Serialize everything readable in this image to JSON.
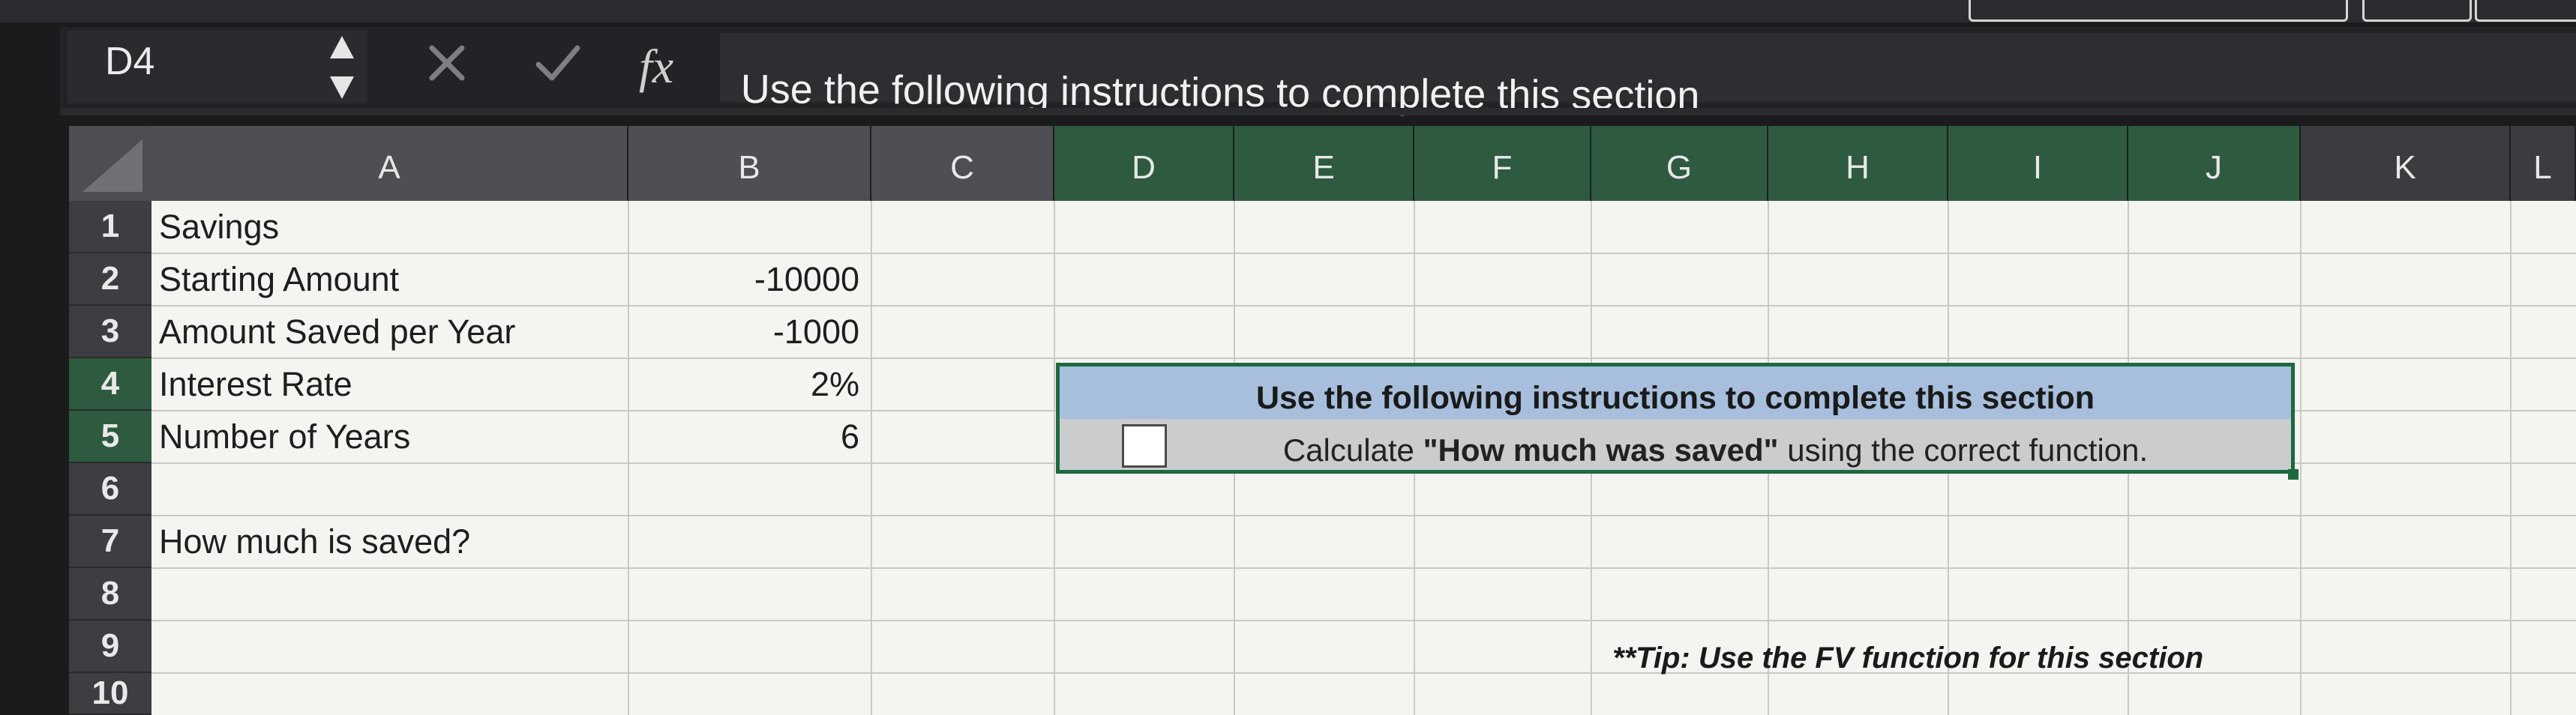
{
  "formula_bar": {
    "name_box": "D4",
    "fx_label": "fx",
    "formula": "Use the following instructions to complete this section"
  },
  "columns": [
    "A",
    "B",
    "C",
    "D",
    "E",
    "F",
    "G",
    "H",
    "I",
    "J",
    "K",
    "L"
  ],
  "rows": [
    "1",
    "2",
    "3",
    "4",
    "5",
    "6",
    "7",
    "8",
    "9",
    "10"
  ],
  "cells": {
    "A1": "Savings",
    "A2": "Starting Amount",
    "B2": "-10000",
    "A3": "Amount Saved per Year",
    "B3": "-1000",
    "A4": "Interest Rate",
    "B4": "2%",
    "A5": "Number of Years",
    "B5": "6",
    "A7": "How much is saved?"
  },
  "instructions": {
    "header": "Use the following instructions to complete this section",
    "task_prefix": "Calculate ",
    "task_bold": "\"How much was saved\"",
    "task_suffix": " using the correct function."
  },
  "tip": "**Tip: Use the FV function for this section",
  "colors": {
    "grid_bg": "#f4f4f1",
    "selection_border": "#1d6a3e",
    "instruction_header": "#a7bfdc",
    "selected_col_header": "#2e5b3f"
  }
}
